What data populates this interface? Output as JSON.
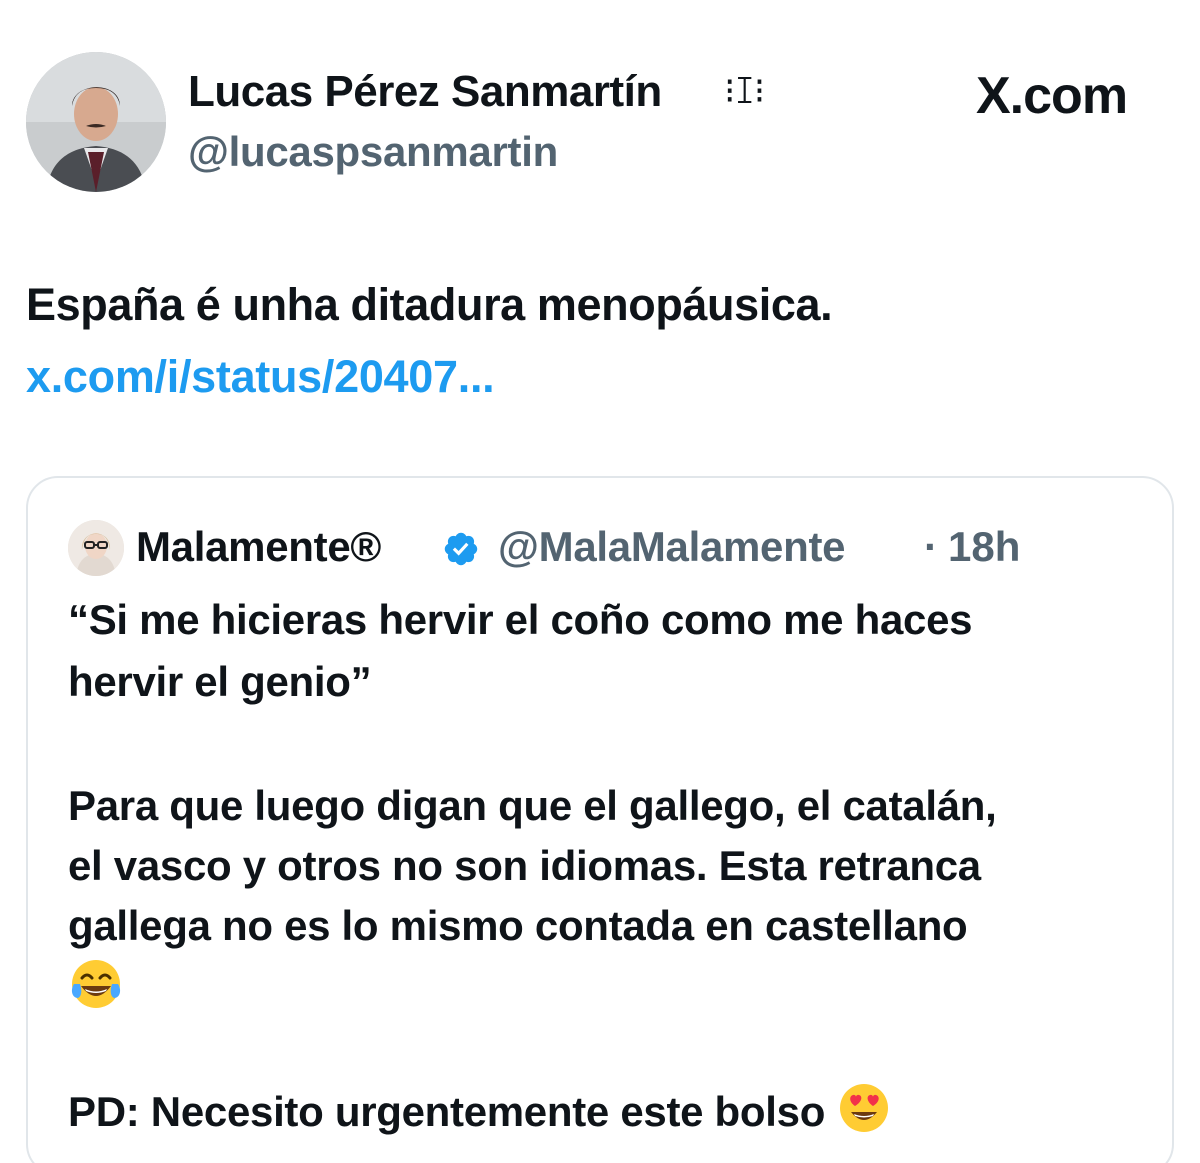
{
  "source": "X.com",
  "author": {
    "name": "Lucas Pérez Sanmartín",
    "name_glyph": "⁝ꕯ⁝",
    "handle": "@lucaspsanmartin"
  },
  "tweet": {
    "text": "España é unha ditadura menopáusica.",
    "link": "x.com/i/status/20407..."
  },
  "quote": {
    "name": "Malamente®",
    "handle": "@MalaMalamente",
    "separator": "·",
    "time": "18h",
    "verified_icon": "verified-badge-icon",
    "lines": [
      "“Si me hicieras hervir el coño como me haces",
      "hervir el genio”",
      "Para que luego digan que el gallego, el catalán,",
      "el vasco y otros no son idiomas. Esta retranca",
      "gallega no es lo mismo contada en castellano",
      "PD: Necesito urgentemente este bolso"
    ],
    "emojis": [
      "tears-of-joy-emoji",
      "heart-eyes-emoji"
    ]
  },
  "colors": {
    "text": "#0f1419",
    "secondary": "#536471",
    "link": "#1d9bf0",
    "border": "#e1e6ea"
  }
}
